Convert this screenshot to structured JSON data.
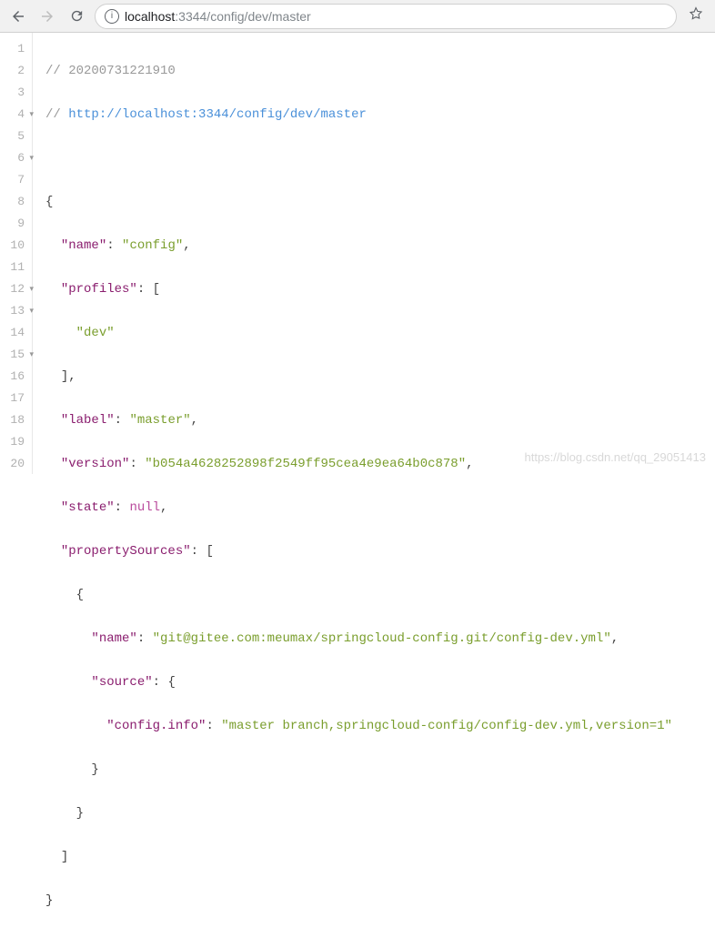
{
  "toolbar": {
    "url_host": "localhost",
    "url_rest": ":3344/config/dev/master"
  },
  "code": {
    "comment_timestamp": "// 20200731221910",
    "comment_url_prefix": "// ",
    "comment_url": "http://localhost:3344/config/dev/master",
    "open_brace": "{",
    "name_key": "\"name\"",
    "name_val": "\"config\"",
    "profiles_key": "\"profiles\"",
    "profiles_open": ": [",
    "profiles_item": "\"dev\"",
    "profiles_close": "],",
    "label_key": "\"label\"",
    "label_val": "\"master\"",
    "version_key": "\"version\"",
    "version_val": "\"b054a4628252898f2549ff95cea4e9ea64b0c878\"",
    "state_key": "\"state\"",
    "state_val": "null",
    "ps_key": "\"propertySources\"",
    "ps_open": ": [",
    "obj_open": "{",
    "ps_name_key": "\"name\"",
    "ps_name_val": "\"git@gitee.com:meumax/springcloud-config.git/config-dev.yml\"",
    "source_key": "\"source\"",
    "source_open": ": {",
    "cfg_key": "\"config.info\"",
    "cfg_val": "\"master branch,springcloud-config/config-dev.yml,version=1\"",
    "inner_close": "}",
    "obj_close": "}",
    "arr_close": "]",
    "close_brace": "}"
  },
  "line_numbers": [
    "1",
    "2",
    "3",
    "4",
    "5",
    "6",
    "7",
    "8",
    "9",
    "10",
    "11",
    "12",
    "13",
    "14",
    "15",
    "16",
    "17",
    "18",
    "19",
    "20"
  ],
  "watermark": "https://blog.csdn.net/qq_29051413"
}
